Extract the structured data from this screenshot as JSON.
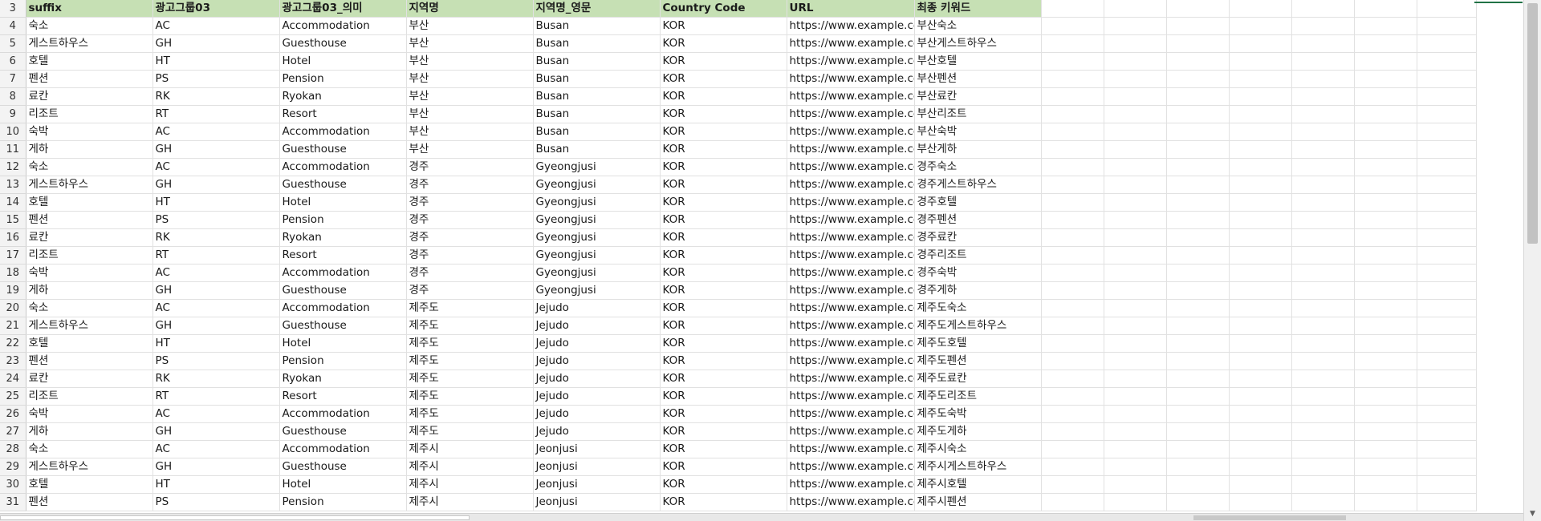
{
  "sheet": {
    "columns": [
      "suffix",
      "광고그룹03",
      "광고그룹03_의미",
      "지역명",
      "지역명_영문",
      "Country Code",
      "URL",
      "최종 키워드"
    ],
    "header_row_number": "3",
    "header_color": "#c6e0b4",
    "accent_color": "#217346",
    "rows": [
      {
        "n": "4",
        "c": [
          "숙소",
          "AC",
          "Accommodation",
          "부산",
          "Busan",
          "KOR",
          "https://www.example.co.kr",
          "부산숙소"
        ]
      },
      {
        "n": "5",
        "c": [
          "게스트하우스",
          "GH",
          "Guesthouse",
          "부산",
          "Busan",
          "KOR",
          "https://www.example.co.kr",
          "부산게스트하우스"
        ]
      },
      {
        "n": "6",
        "c": [
          "호텔",
          "HT",
          "Hotel",
          "부산",
          "Busan",
          "KOR",
          "https://www.example.co.kr",
          "부산호텔"
        ]
      },
      {
        "n": "7",
        "c": [
          "펜션",
          "PS",
          "Pension",
          "부산",
          "Busan",
          "KOR",
          "https://www.example.co.kr",
          "부산펜션"
        ]
      },
      {
        "n": "8",
        "c": [
          "료칸",
          "RK",
          "Ryokan",
          "부산",
          "Busan",
          "KOR",
          "https://www.example.co.kr",
          "부산료칸"
        ]
      },
      {
        "n": "9",
        "c": [
          "리조트",
          "RT",
          "Resort",
          "부산",
          "Busan",
          "KOR",
          "https://www.example.co.kr",
          "부산리조트"
        ]
      },
      {
        "n": "10",
        "c": [
          "숙박",
          "AC",
          "Accommodation",
          "부산",
          "Busan",
          "KOR",
          "https://www.example.co.kr",
          "부산숙박"
        ]
      },
      {
        "n": "11",
        "c": [
          "게하",
          "GH",
          "Guesthouse",
          "부산",
          "Busan",
          "KOR",
          "https://www.example.co.kr",
          "부산게하"
        ]
      },
      {
        "n": "12",
        "c": [
          "숙소",
          "AC",
          "Accommodation",
          "경주",
          "Gyeongjusi",
          "KOR",
          "https://www.example.co.kr",
          "경주숙소"
        ]
      },
      {
        "n": "13",
        "c": [
          "게스트하우스",
          "GH",
          "Guesthouse",
          "경주",
          "Gyeongjusi",
          "KOR",
          "https://www.example.co.kr",
          "경주게스트하우스"
        ]
      },
      {
        "n": "14",
        "c": [
          "호텔",
          "HT",
          "Hotel",
          "경주",
          "Gyeongjusi",
          "KOR",
          "https://www.example.co.kr",
          "경주호텔"
        ]
      },
      {
        "n": "15",
        "c": [
          "펜션",
          "PS",
          "Pension",
          "경주",
          "Gyeongjusi",
          "KOR",
          "https://www.example.co.kr",
          "경주펜션"
        ]
      },
      {
        "n": "16",
        "c": [
          "료칸",
          "RK",
          "Ryokan",
          "경주",
          "Gyeongjusi",
          "KOR",
          "https://www.example.co.kr",
          "경주료칸"
        ]
      },
      {
        "n": "17",
        "c": [
          "리조트",
          "RT",
          "Resort",
          "경주",
          "Gyeongjusi",
          "KOR",
          "https://www.example.co.kr",
          "경주리조트"
        ]
      },
      {
        "n": "18",
        "c": [
          "숙박",
          "AC",
          "Accommodation",
          "경주",
          "Gyeongjusi",
          "KOR",
          "https://www.example.co.kr",
          "경주숙박"
        ]
      },
      {
        "n": "19",
        "c": [
          "게하",
          "GH",
          "Guesthouse",
          "경주",
          "Gyeongjusi",
          "KOR",
          "https://www.example.co.kr",
          "경주게하"
        ]
      },
      {
        "n": "20",
        "c": [
          "숙소",
          "AC",
          "Accommodation",
          "제주도",
          "Jejudo",
          "KOR",
          "https://www.example.co.kr",
          "제주도숙소"
        ]
      },
      {
        "n": "21",
        "c": [
          "게스트하우스",
          "GH",
          "Guesthouse",
          "제주도",
          "Jejudo",
          "KOR",
          "https://www.example.co.kr",
          "제주도게스트하우스"
        ]
      },
      {
        "n": "22",
        "c": [
          "호텔",
          "HT",
          "Hotel",
          "제주도",
          "Jejudo",
          "KOR",
          "https://www.example.co.kr",
          "제주도호텔"
        ]
      },
      {
        "n": "23",
        "c": [
          "펜션",
          "PS",
          "Pension",
          "제주도",
          "Jejudo",
          "KOR",
          "https://www.example.co.kr",
          "제주도펜션"
        ]
      },
      {
        "n": "24",
        "c": [
          "료칸",
          "RK",
          "Ryokan",
          "제주도",
          "Jejudo",
          "KOR",
          "https://www.example.co.kr",
          "제주도료칸"
        ]
      },
      {
        "n": "25",
        "c": [
          "리조트",
          "RT",
          "Resort",
          "제주도",
          "Jejudo",
          "KOR",
          "https://www.example.co.kr",
          "제주도리조트"
        ]
      },
      {
        "n": "26",
        "c": [
          "숙박",
          "AC",
          "Accommodation",
          "제주도",
          "Jejudo",
          "KOR",
          "https://www.example.co.kr",
          "제주도숙박"
        ]
      },
      {
        "n": "27",
        "c": [
          "게하",
          "GH",
          "Guesthouse",
          "제주도",
          "Jejudo",
          "KOR",
          "https://www.example.co.kr",
          "제주도게하"
        ]
      },
      {
        "n": "28",
        "c": [
          "숙소",
          "AC",
          "Accommodation",
          "제주시",
          "Jeonjusi",
          "KOR",
          "https://www.example.co.kr",
          "제주시숙소"
        ]
      },
      {
        "n": "29",
        "c": [
          "게스트하우스",
          "GH",
          "Guesthouse",
          "제주시",
          "Jeonjusi",
          "KOR",
          "https://www.example.co.kr",
          "제주시게스트하우스"
        ]
      },
      {
        "n": "30",
        "c": [
          "호텔",
          "HT",
          "Hotel",
          "제주시",
          "Jeonjusi",
          "KOR",
          "https://www.example.co.kr",
          "제주시호텔"
        ]
      },
      {
        "n": "31",
        "c": [
          "펜션",
          "PS",
          "Pension",
          "제주시",
          "Jeonjusi",
          "KOR",
          "https://www.example.co.kr",
          "제주시펜션"
        ]
      }
    ]
  },
  "scrollbar": {
    "down_arrow_icon": "chevron-down-icon"
  }
}
